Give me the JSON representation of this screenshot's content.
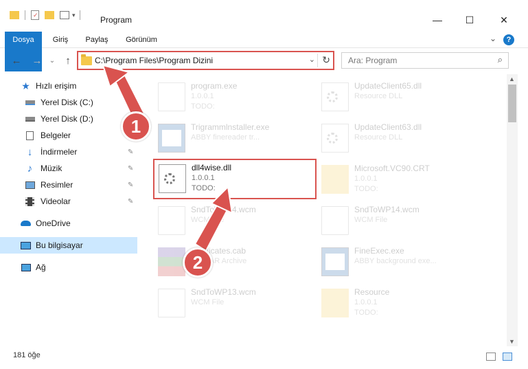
{
  "window": {
    "title": "Program",
    "minimize": "—",
    "maximize": "☐",
    "close": "✕"
  },
  "ribbon": {
    "tabs": [
      "Dosya",
      "Giriş",
      "Paylaş",
      "Görünüm"
    ],
    "help": "?"
  },
  "nav": {
    "address": "C:\\Program Files\\Program Dizini",
    "search_placeholder": "Ara: Program"
  },
  "sidebar": {
    "items": [
      {
        "label": "Hızlı erişim",
        "icon": "star-icon"
      },
      {
        "label": "Yerel Disk (C:)",
        "icon": "drive-icon"
      },
      {
        "label": "Yerel Disk (D:)",
        "icon": "drive-icon"
      },
      {
        "label": "Belgeler",
        "icon": "documents-icon"
      },
      {
        "label": "İndirmeler",
        "icon": "download-icon"
      },
      {
        "label": "Müzik",
        "icon": "music-icon"
      },
      {
        "label": "Resimler",
        "icon": "pictures-icon"
      },
      {
        "label": "Videolar",
        "icon": "video-icon"
      },
      {
        "label": "OneDrive",
        "icon": "cloud-icon"
      },
      {
        "label": "Bu bilgisayar",
        "icon": "computer-icon"
      },
      {
        "label": "Ağ",
        "icon": "network-icon"
      }
    ]
  },
  "files": [
    {
      "name": "program.exe",
      "line2": "1.0.0.1",
      "line3": "TODO:"
    },
    {
      "name": "UpdateClient65.dll",
      "line2": "Resource DLL",
      "line3": ""
    },
    {
      "name": "Trigrammlnstaller.exe",
      "line2": "ABBY finereader tr...",
      "line3": ""
    },
    {
      "name": "UpdateClient63.dll",
      "line2": "Resource DLL",
      "line3": ""
    },
    {
      "name": "dll4wise.dll",
      "line2": "1.0.0.1",
      "line3": "TODO:"
    },
    {
      "name": "Microsoft.VC90.CRT",
      "line2": "1.0.0.1",
      "line3": "TODO:"
    },
    {
      "name": "SndToWP14.wcm",
      "line2": "WCM File",
      "line3": ""
    },
    {
      "name": "SndToWP14.wcm",
      "line2": "WCM File",
      "line3": ""
    },
    {
      "name": "certificates.cab",
      "line2": "WinRAR Archive",
      "line3": ""
    },
    {
      "name": "FineExec.exe",
      "line2": "ABBY background exe...",
      "line3": ""
    },
    {
      "name": "SndToWP13.wcm",
      "line2": "WCM File",
      "line3": ""
    },
    {
      "name": "Resource",
      "line2": "1.0.0.1",
      "line3": "TODO:"
    }
  ],
  "status": {
    "count": "181 öğe"
  },
  "annotations": {
    "step1": "1",
    "step2": "2",
    "color": "#d9534f"
  }
}
